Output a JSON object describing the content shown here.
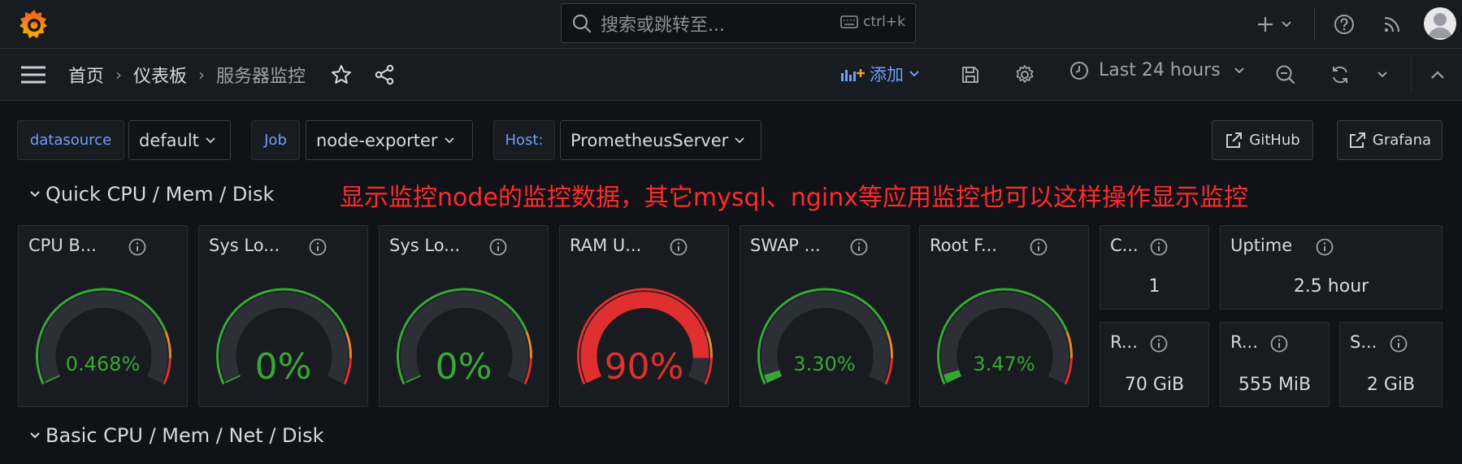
{
  "topbar": {
    "search_placeholder": "搜索或跳转至...",
    "search_shortcut": "ctrl+k",
    "icons": [
      "grafana-logo",
      "search-icon",
      "keyboard-icon",
      "plus-icon",
      "chevron-down-icon",
      "help-icon",
      "rss-icon",
      "avatar"
    ]
  },
  "navbar": {
    "breadcrumbs": [
      "首页",
      "仪表板",
      "服务器监控"
    ],
    "add_label": "添加",
    "time_range": "Last 24 hours"
  },
  "variables": {
    "datasource_label": "datasource",
    "datasource_value": "default",
    "job_label": "Job",
    "job_value": "node-exporter",
    "host_label": "Host:",
    "host_value": "PrometheusServer"
  },
  "links": {
    "github": "GitHub",
    "grafana": "Grafana"
  },
  "rows": {
    "quick": "Quick CPU / Mem / Disk",
    "basic": "Basic CPU / Mem / Net / Disk"
  },
  "annotation": "显示监控node的监控数据，其它mysql、nginx等应用监控也可以这样操作显示监控",
  "gauges": [
    {
      "title": "CPU B...",
      "display": "0.468%",
      "value": 0.468,
      "color": "#37a835"
    },
    {
      "title": "Sys Lo...",
      "display": "0%",
      "value": 0,
      "color": "#37a835"
    },
    {
      "title": "Sys Lo...",
      "display": "0%",
      "value": 0,
      "color": "#37a835"
    },
    {
      "title": "RAM U...",
      "display": "90%",
      "value": 90,
      "color": "#e02f2f"
    },
    {
      "title": "SWAP ...",
      "display": "3.30%",
      "value": 3.3,
      "color": "#37a835"
    },
    {
      "title": "Root F...",
      "display": "3.47%",
      "value": 3.47,
      "color": "#37a835"
    }
  ],
  "stats": [
    {
      "title": "C...",
      "value": "1"
    },
    {
      "title": "Uptime",
      "value": "2.5 hour"
    },
    {
      "title": "R...",
      "value": "70 GiB"
    },
    {
      "title": "R...",
      "value": "555 MiB"
    },
    {
      "title": "S...",
      "value": "2 GiB"
    }
  ],
  "colors": {
    "background": "#111217",
    "panel": "#181b1f",
    "accent_blue": "#6e9fff",
    "green": "#37a835",
    "orange": "#e8872c",
    "red": "#e02f2f",
    "annotation_red": "#ff2b2b"
  }
}
